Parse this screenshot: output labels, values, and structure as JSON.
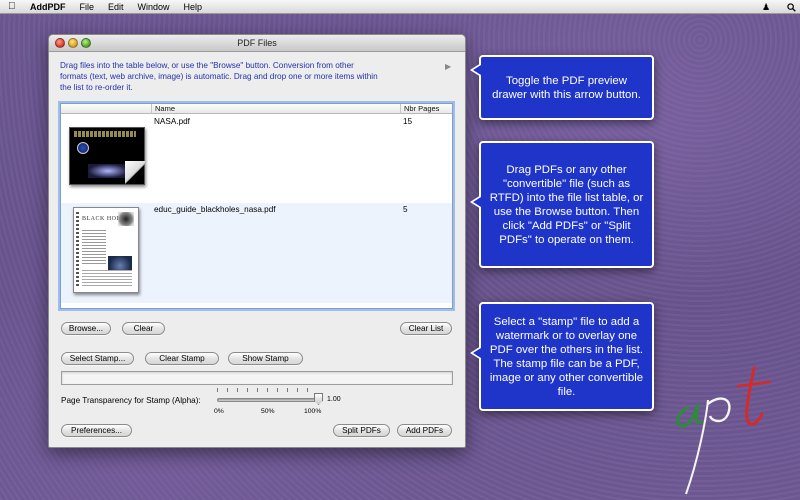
{
  "menubar": {
    "app_name": "AddPDF",
    "items": [
      "File",
      "Edit",
      "Window",
      "Help"
    ]
  },
  "window": {
    "title": "PDF Files",
    "intro_text": "Drag files into the table below, or use the \"Browse\" button. Conversion from other formats (text, web archive, image) is automatic. Drag and drop one or more items within the list to re-order it.",
    "table": {
      "columns": [
        "Name",
        "Nbr Pages"
      ],
      "rows": [
        {
          "name": "NASA.pdf",
          "pages": "15"
        },
        {
          "name": "educ_guide_blackholes_nasa.pdf",
          "pages": "5"
        }
      ]
    },
    "buttons": {
      "browse": "Browse...",
      "clear": "Clear",
      "clear_list": "Clear List",
      "select_stamp": "Select Stamp...",
      "clear_stamp": "Clear Stamp",
      "show_stamp": "Show Stamp",
      "preferences": "Preferences...",
      "split_pdfs": "Split PDFs",
      "add_pdfs": "Add PDFs"
    },
    "stamp_path": "",
    "alpha": {
      "label": "Page Transparency for Stamp (Alpha):",
      "value": 1.0,
      "value_text": "1.00",
      "scale_labels": [
        "0%",
        "50%",
        "100%"
      ]
    }
  },
  "callouts": [
    "Toggle the PDF preview drawer with this arrow button.",
    "Drag PDFs or any other \"convertible\"  file (such as RTFD) into the file list table, or use the Browse button. Then click \"Add PDFs\" or \"Split PDFs\" to operate on them.",
    "Select a \"stamp\" file to add a watermark or to overlay one PDF over the others in the list. The stamp file can be a PDF, image or any other convertible file."
  ],
  "icons": {
    "apple": "apple-icon",
    "user": "user-icon",
    "search": "search-icon",
    "drawer_toggle": "disclosure-arrow-icon"
  },
  "colors": {
    "callout_bg": "#1f35c9",
    "desktop": "#6a5590",
    "intro_text": "#2233aa"
  }
}
